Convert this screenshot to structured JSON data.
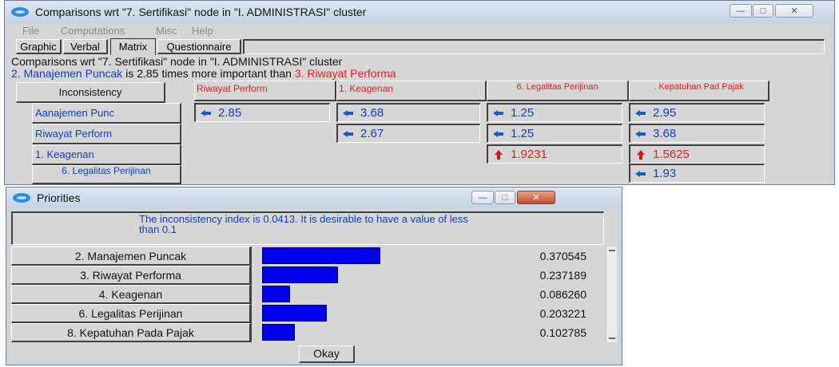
{
  "comparisons_window": {
    "title": "Comparisons wrt \"7. Sertifikasi\" node in \"I. ADMINISTRASI\" cluster",
    "menu": [
      "File",
      "Computations",
      "Misc",
      "Help"
    ],
    "tabs": [
      "Graphic",
      "Verbal",
      "Matrix",
      "Questionnaire"
    ],
    "active_tab": "Matrix",
    "info_line1": "Comparisons wrt \"7. Sertifikasi\" node in \"I. ADMINISTRASI\" cluster",
    "info_line2": {
      "node_a": "2. Manajemen Puncak",
      "middle": " is 2.85 times more important than ",
      "node_b": "3. Riwayat Performa"
    },
    "inconsistency_button": "Inconsistency",
    "column_headers": [
      "Riwayat Perform",
      "1. Keagenan",
      "6. Legalitas Perijinan",
      ". Kepatuhan Pad Pajak"
    ],
    "row_headers": [
      "Aanajemen Punc",
      "Riwayat Perform",
      "1. Keagenan",
      "6. Legalitas Perijinan"
    ],
    "cells": {
      "r0c0": "2.85",
      "r0c1": "3.68",
      "r0c2": "1.25",
      "r0c3": "2.95",
      "r1c1": "2.67",
      "r1c2": "1.25",
      "r1c3": "3.68",
      "r2c2": "1.9231",
      "r2c3": "1.5625",
      "r3c3": "1.93"
    },
    "colors": {
      "blue": "#1040c0",
      "red": "#e02020",
      "arrow_blue": "#1060c0",
      "arrow_red": "#e01010"
    }
  },
  "priorities_window": {
    "title": "Priorities",
    "message": "The inconsistency index is 0.0413.  It is desirable to have a value of less than 0.1",
    "rows": [
      {
        "name": "2. Manajemen Puncak",
        "value": "0.370545",
        "fraction": 0.370545
      },
      {
        "name": "3. Riwayat Performa",
        "value": "0.237189",
        "fraction": 0.237189
      },
      {
        "name": "4. Keagenan",
        "value": "0.086260",
        "fraction": 0.08626
      },
      {
        "name": "6. Legalitas Perijinan",
        "value": "0.203221",
        "fraction": 0.203221
      },
      {
        "name": "8. Kepatuhan Pada Pajak",
        "value": "0.102785",
        "fraction": 0.102785
      }
    ],
    "ok_button": "Okay",
    "bar_color": "#0000ee"
  }
}
